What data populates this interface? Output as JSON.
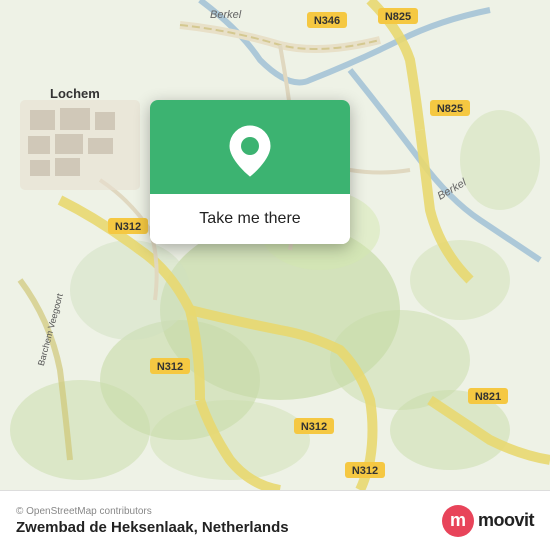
{
  "map": {
    "alt": "Map showing Zwembad de Heksenlaak area near Lochem, Netherlands"
  },
  "popup": {
    "button_label": "Take me there"
  },
  "bottom_bar": {
    "copyright": "© OpenStreetMap contributors",
    "location_name": "Zwembad de Heksenlaak, Netherlands"
  },
  "moovit": {
    "logo_letter": "m",
    "brand_name": "moovit",
    "brand_color": "#e8445a"
  },
  "road_labels": {
    "n346": "N346",
    "n825_top": "N825",
    "n825_right": "N825",
    "n312_left": "N312",
    "n312_mid": "N312",
    "n312_bottom": "N312",
    "n312_lower": "N312",
    "n821": "N821",
    "berkel_top": "Berkel",
    "berkel_right": "Berkel",
    "lochem": "Lochem",
    "berkel_town": "Berkel",
    "barchem_veegoort": "Barchem Veegoort"
  }
}
